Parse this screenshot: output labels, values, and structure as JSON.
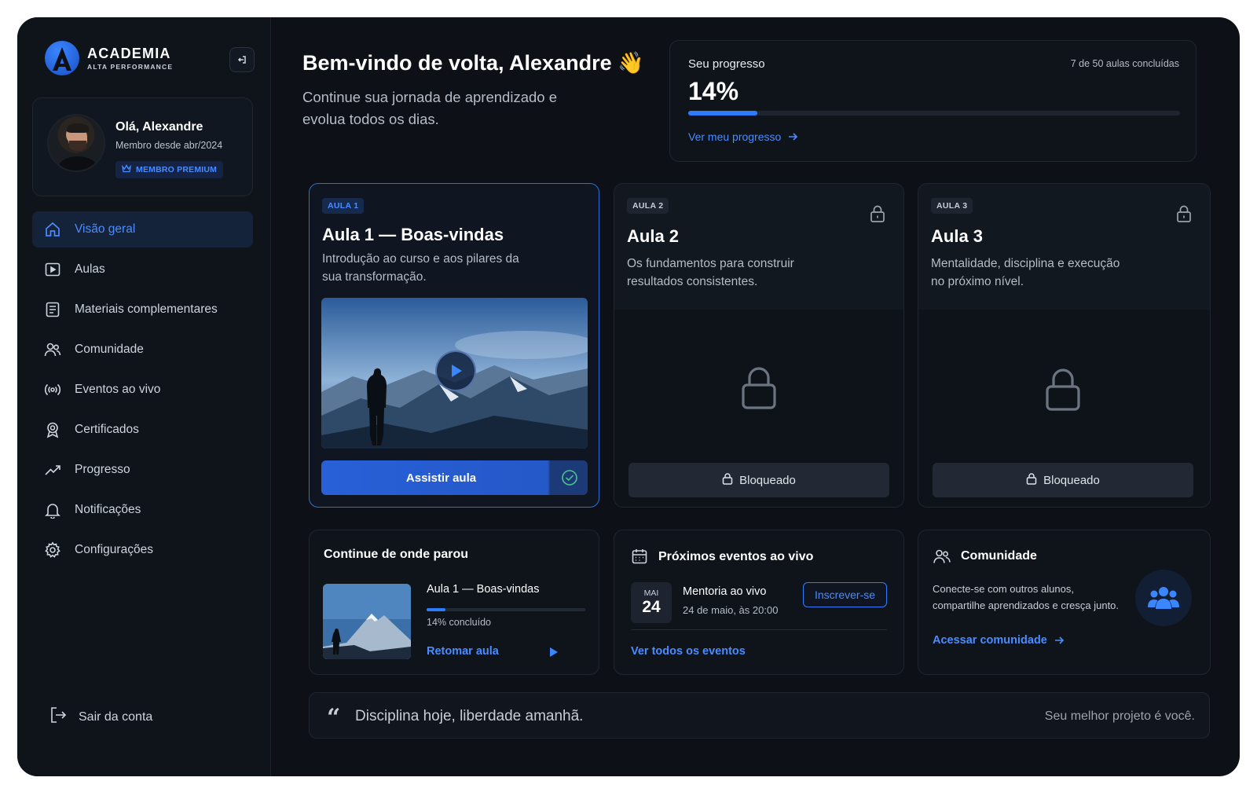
{
  "brand": {
    "name": "ACADEMIA",
    "subtitle": "ALTA PERFORMANCE"
  },
  "profile": {
    "greeting": "Olá, Alexandre",
    "member_since": "Membro desde abr/2024",
    "badge": "MEMBRO PREMIUM"
  },
  "nav": {
    "items": [
      {
        "label": "Visão geral",
        "icon": "home-icon",
        "active": true
      },
      {
        "label": "Aulas",
        "icon": "play-square-icon"
      },
      {
        "label": "Materiais complementares",
        "icon": "document-icon"
      },
      {
        "label": "Comunidade",
        "icon": "users-icon"
      },
      {
        "label": "Eventos ao vivo",
        "icon": "broadcast-icon"
      },
      {
        "label": "Certificados",
        "icon": "award-icon"
      },
      {
        "label": "Progresso",
        "icon": "trending-up-icon"
      },
      {
        "label": "Notificações",
        "icon": "bell-icon"
      },
      {
        "label": "Configurações",
        "icon": "gear-icon"
      }
    ],
    "logout": "Sair da conta"
  },
  "header": {
    "title": "Bem-vindo de volta, Alexandre 👋",
    "subtitle": "Continue sua jornada de aprendizado e evolua todos os dias."
  },
  "progress": {
    "label": "Seu progresso",
    "count": "7 de 50 aulas concluídas",
    "percent_text": "14%",
    "percent": 14,
    "link": "Ver meu progresso"
  },
  "lessons": [
    {
      "tag": "AULA 1",
      "title": "Aula 1 — Boas-vindas",
      "description": "Introdução ao curso e aos pilares da sua transformação.",
      "button": "Assistir aula",
      "locked": false
    },
    {
      "tag": "AULA 2",
      "title": "Aula 2",
      "description": "Os fundamentos para construir resultados consistentes.",
      "button": "Bloqueado",
      "locked": true
    },
    {
      "tag": "AULA 3",
      "title": "Aula 3",
      "description": "Mentalidade, disciplina e execução no próximo nível.",
      "button": "Bloqueado",
      "locked": true
    }
  ],
  "continue": {
    "title": "Continue de onde parou",
    "lesson": "Aula 1 — Boas-vindas",
    "percent": 14,
    "percent_text": "14% concluído",
    "link": "Retomar aula"
  },
  "events": {
    "title": "Próximos eventos ao vivo",
    "month": "MAI",
    "day": "24",
    "name": "Mentoria ao vivo",
    "time": "24 de maio, às 20:00",
    "button": "Inscrever-se",
    "link": "Ver todos os eventos"
  },
  "community": {
    "title": "Comunidade",
    "text": "Conecte-se com outros alunos, compartilhe aprendizados e cresça junto.",
    "link": "Acessar comunidade"
  },
  "quote": {
    "text": "Disciplina hoje, liberdade amanhã.",
    "right": "Seu melhor projeto é você."
  },
  "colors": {
    "accent": "#2f7bff",
    "background": "#0d1117",
    "panel": "#0f141b"
  }
}
